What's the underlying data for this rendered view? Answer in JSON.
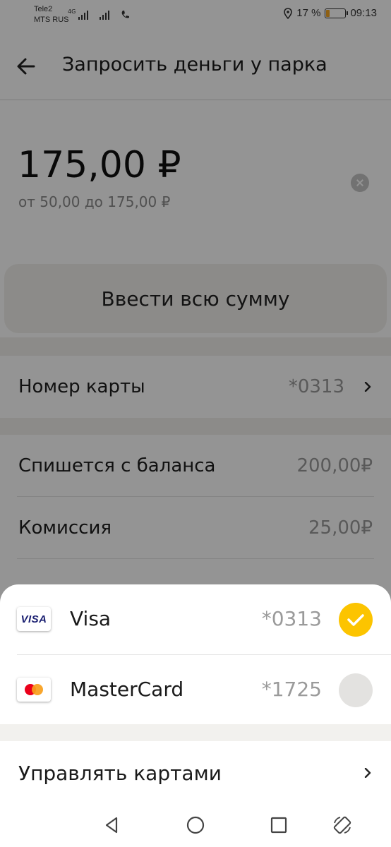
{
  "status_bar": {
    "carrier_1": "Tele2",
    "carrier_2": "MTS RUS",
    "network": "4G",
    "battery_text": "17 %",
    "battery_level": 0.17,
    "time": "09:13"
  },
  "header": {
    "title": "Запросить деньги у парка",
    "back_icon": "arrow-left-icon"
  },
  "amount": {
    "value": "175,00 ₽",
    "range": "от 50,00 до 175,00 ₽",
    "clear_icon": "clear-icon"
  },
  "enter_all_button": "Ввести всю сумму",
  "card_field": {
    "label": "Номер карты",
    "value": "*0313"
  },
  "summary": {
    "rows": [
      {
        "label": "Спишется с баланса",
        "value": "200,00₽"
      },
      {
        "label": "Комиссия",
        "value": "25,00₽"
      }
    ]
  },
  "card_sheet": {
    "cards": [
      {
        "brand": "Visa",
        "logo_text": "VISA",
        "number": "*0313",
        "selected": true
      },
      {
        "brand": "MasterCard",
        "number": "*1725",
        "selected": false
      }
    ],
    "manage_label": "Управлять картами"
  },
  "colors": {
    "accent": "#fcc400",
    "dim_overlay": "rgba(0,0,0,0.42)"
  },
  "nav": {
    "icons": [
      "back-triangle-icon",
      "home-circle-icon",
      "recents-square-icon",
      "rotate-icon"
    ]
  }
}
